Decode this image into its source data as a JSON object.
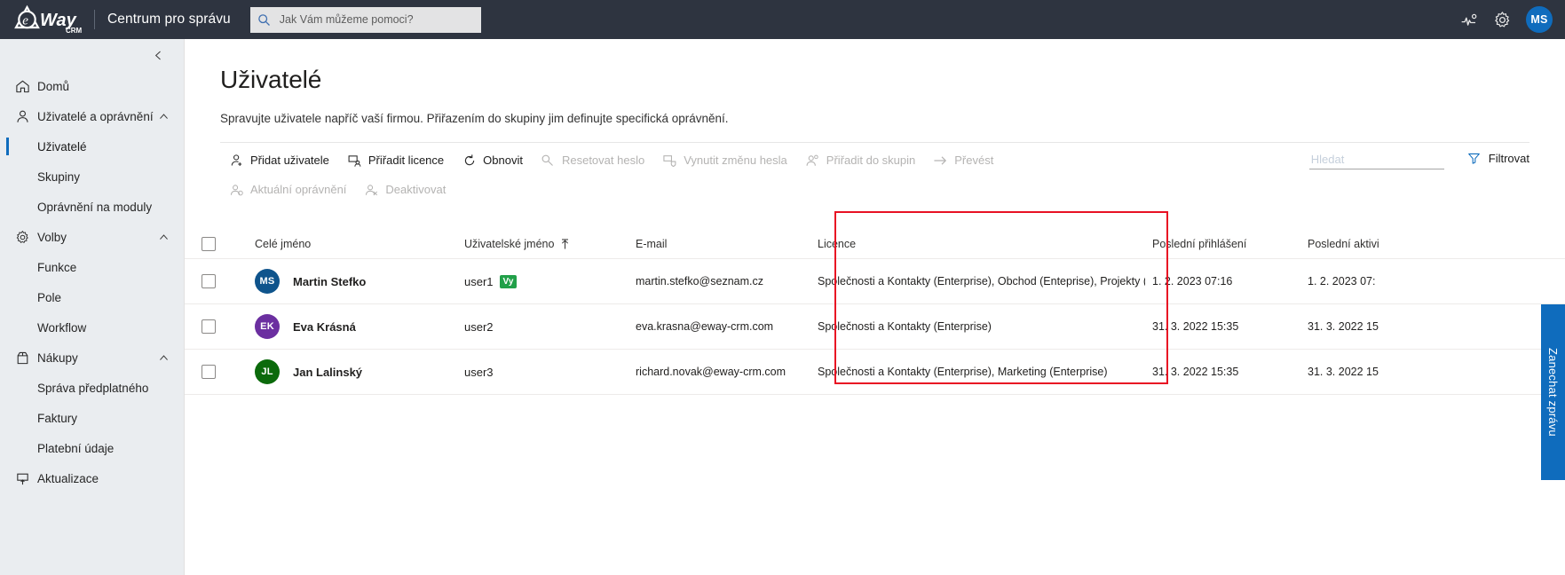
{
  "topbar": {
    "logo_text": "Way",
    "logo_sub": "CRM",
    "suite_name": "Centrum pro správu",
    "search_placeholder": "Jak Vám můžeme pomoci?",
    "search_value": "",
    "icons": {
      "diagnostics": "diagnostics-icon",
      "settings": "gear-icon"
    },
    "avatar_initials": "MS",
    "avatar_color": "#0f6cbd"
  },
  "sidebar": {
    "collapse_icon": "chevron-left-icon",
    "items": [
      {
        "label": "Domů",
        "icon": "home-icon",
        "type": "top",
        "expandable": false
      },
      {
        "label": "Uživatelé a oprávnění",
        "icon": "person-icon",
        "type": "top",
        "expandable": true
      },
      {
        "label": "Uživatelé",
        "type": "sub",
        "active": true
      },
      {
        "label": "Skupiny",
        "type": "sub",
        "active": false
      },
      {
        "label": "Oprávnění na moduly",
        "type": "sub",
        "active": false
      },
      {
        "label": "Volby",
        "icon": "gear-icon",
        "type": "top",
        "expandable": true
      },
      {
        "label": "Funkce",
        "type": "sub",
        "active": false
      },
      {
        "label": "Pole",
        "type": "sub",
        "active": false
      },
      {
        "label": "Workflow",
        "type": "sub",
        "active": false
      },
      {
        "label": "Nákupy",
        "icon": "bag-icon",
        "type": "top",
        "expandable": true
      },
      {
        "label": "Správa předplatného",
        "type": "sub",
        "active": false
      },
      {
        "label": "Faktury",
        "type": "sub",
        "active": false
      },
      {
        "label": "Platební údaje",
        "type": "sub",
        "active": false
      },
      {
        "label": "Aktualizace",
        "icon": "update-icon",
        "type": "top",
        "expandable": false
      }
    ]
  },
  "page": {
    "title": "Uživatelé",
    "description": "Spravujte uživatele napříč vaší firmou. Přiřazením do skupiny jim definujte specifická oprávnění."
  },
  "toolbar": {
    "row1": [
      {
        "label": "Přidat uživatele",
        "icon": "add-person-icon",
        "disabled": false
      },
      {
        "label": "Přiřadit licence",
        "icon": "assign-license-icon",
        "disabled": false
      },
      {
        "label": "Obnovit",
        "icon": "refresh-icon",
        "disabled": false
      },
      {
        "label": "Resetovat heslo",
        "icon": "key-icon",
        "disabled": true
      },
      {
        "label": "Vynutit změnu hesla",
        "icon": "shield-person-icon",
        "disabled": true
      },
      {
        "label": "Přiřadit do skupin",
        "icon": "group-person-icon",
        "disabled": true
      },
      {
        "label": "Převést",
        "icon": "arrow-right-icon",
        "disabled": true
      }
    ],
    "row2": [
      {
        "label": "Aktuální oprávnění",
        "icon": "permission-person-icon",
        "disabled": true
      },
      {
        "label": "Deaktivovat",
        "icon": "deactivate-person-icon",
        "disabled": true
      }
    ],
    "search_placeholder": "Hledat",
    "search_value": "",
    "filter_label": "Filtrovat",
    "filter_icon": "funnel-icon"
  },
  "table": {
    "columns": [
      {
        "key": "name",
        "label": "Celé jméno"
      },
      {
        "key": "username",
        "label": "Uživatelské jméno",
        "sorted": true,
        "sort_dir": "asc"
      },
      {
        "key": "email",
        "label": "E-mail"
      },
      {
        "key": "licence",
        "label": "Licence"
      },
      {
        "key": "last_login",
        "label": "Poslední přihlášení"
      },
      {
        "key": "last_activity",
        "label": "Poslední aktivi"
      }
    ],
    "rows": [
      {
        "initials": "MS",
        "avatar_color": "#0f548c",
        "name": "Martin Stefko",
        "username": "user1",
        "badge": "Vy",
        "email": "martin.stefko@seznam.cz",
        "licence": "Společnosti a Kontakty (Enterprise), Obchod (Enteprise), Projekty (Enterprise),",
        "last_login": "1. 2. 2023 07:16",
        "last_activity": "1. 2. 2023 07:"
      },
      {
        "initials": "EK",
        "avatar_color": "#6b2fa0",
        "name": "Eva Krásná",
        "username": "user2",
        "badge": "",
        "email": "eva.krasna@eway-crm.com",
        "licence": "Společnosti a Kontakty (Enterprise)",
        "last_login": "31. 3. 2022 15:35",
        "last_activity": "31. 3. 2022 15"
      },
      {
        "initials": "JL",
        "avatar_color": "#0b6a0b",
        "name": "Jan Lalinský",
        "username": "user3",
        "badge": "",
        "email": "richard.novak@eway-crm.com",
        "licence": "Společnosti a Kontakty (Enterprise), Marketing (Enterprise)",
        "last_login": "31. 3. 2022 15:35",
        "last_activity": "31. 3. 2022 15"
      }
    ]
  },
  "annotation": {
    "color": "#e81123",
    "target_column": "Licence"
  },
  "feedback_tab": {
    "label": "Zanechat zprávu",
    "color": "#0f6cbd"
  }
}
